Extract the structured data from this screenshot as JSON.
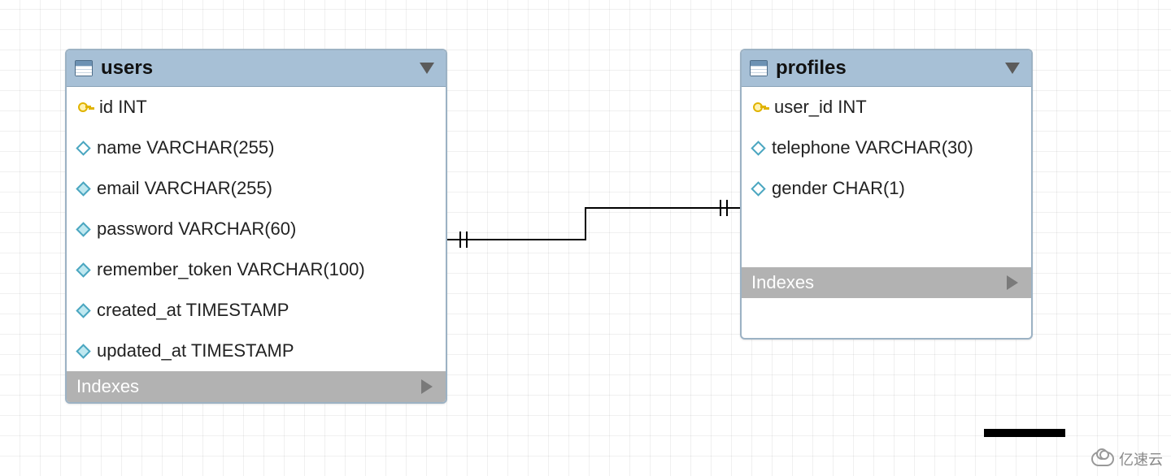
{
  "watermark": {
    "text": "亿速云"
  },
  "tables": {
    "users": {
      "title": "users",
      "indexes_label": "Indexes",
      "columns": [
        {
          "icon": "key",
          "label": "id INT"
        },
        {
          "icon": "diamond-h",
          "label": "name VARCHAR(255)"
        },
        {
          "icon": "diamond",
          "label": "email VARCHAR(255)"
        },
        {
          "icon": "diamond",
          "label": "password VARCHAR(60)"
        },
        {
          "icon": "diamond",
          "label": "remember_token VARCHAR(100)"
        },
        {
          "icon": "diamond",
          "label": "created_at TIMESTAMP"
        },
        {
          "icon": "diamond",
          "label": "updated_at TIMESTAMP"
        }
      ]
    },
    "profiles": {
      "title": "profiles",
      "indexes_label": "Indexes",
      "columns": [
        {
          "icon": "key",
          "label": "user_id INT"
        },
        {
          "icon": "diamond-h",
          "label": "telephone VARCHAR(30)"
        },
        {
          "icon": "diamond-h",
          "label": "gender CHAR(1)"
        }
      ]
    }
  },
  "relationship": {
    "from": "users",
    "to": "profiles",
    "type": "one-to-one"
  }
}
